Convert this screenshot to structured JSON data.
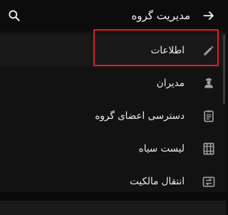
{
  "toolbar": {
    "title": "مدیریت گروه",
    "back_icon": "arrow-forward-icon",
    "search_icon": "search-icon"
  },
  "menu": {
    "items": [
      {
        "label": "اطلاعات",
        "icon": "pencil-icon",
        "highlighted": true
      },
      {
        "label": "مدیران",
        "icon": "admin-badge-icon",
        "highlighted": false
      },
      {
        "label": "دسترسی اعضای گروه",
        "icon": "clipboard-icon",
        "highlighted": false
      },
      {
        "label": "لیست سیاه",
        "icon": "blocked-list-icon",
        "highlighted": false
      },
      {
        "label": "انتقال مالکیت",
        "icon": "transfer-ownership-icon",
        "highlighted": false
      }
    ]
  },
  "colors": {
    "background": "#121212",
    "text": "#ececec",
    "icon": "#9e9e9e",
    "highlight_border": "#e01d2b"
  }
}
